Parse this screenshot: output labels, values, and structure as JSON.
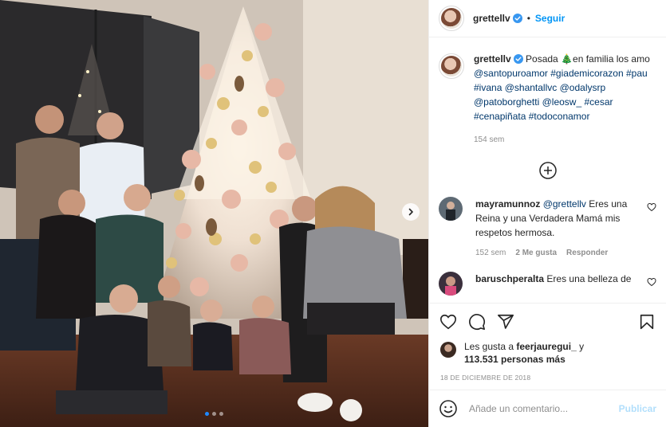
{
  "post": {
    "username": "grettellv",
    "separator": "•",
    "follow_label": "Seguir"
  },
  "caption": {
    "username": "grettellv",
    "text_before": "Posada ",
    "tree_emoji": "🎄",
    "text_after": "en familia los amo",
    "tags": [
      "@santopuroamor",
      "#giademicorazon",
      "#pau",
      "#ivana",
      "@shantallvc",
      "@odalysrp",
      "@patoborghetti",
      "@leosw_",
      "#cesar",
      "#cenapiñata",
      "#todoconamor"
    ],
    "time": "154 sem"
  },
  "comments": [
    {
      "username": "mayramunnoz",
      "mention": "@grettellv",
      "text": "Eres una Reina y una Verdadera Mamá mis respetos hermosa.",
      "time": "152 sem",
      "likes": "2 Me gusta",
      "reply": "Responder"
    },
    {
      "username": "baruschperalta",
      "text": "Eres una belleza de"
    }
  ],
  "likes": {
    "prefix": "Les gusta a",
    "user": "feerjauregui_",
    "joiner": "y",
    "count": "113.531 personas más"
  },
  "date": "18 DE DICIEMBRE DE 2018",
  "add_comment": {
    "placeholder": "Añade un comentario...",
    "post_label": "Publicar"
  },
  "carousel": {
    "current": 1,
    "total": 3
  },
  "colors": {
    "accent": "#0095f6",
    "verified": "#3897f0",
    "link": "#00376b",
    "muted": "#8e8e8e"
  },
  "icons": [
    "verified-badge-icon",
    "plus-circle-icon",
    "heart-icon",
    "comment-icon",
    "share-icon",
    "bookmark-icon",
    "emoji-icon",
    "chevron-right-icon"
  ]
}
